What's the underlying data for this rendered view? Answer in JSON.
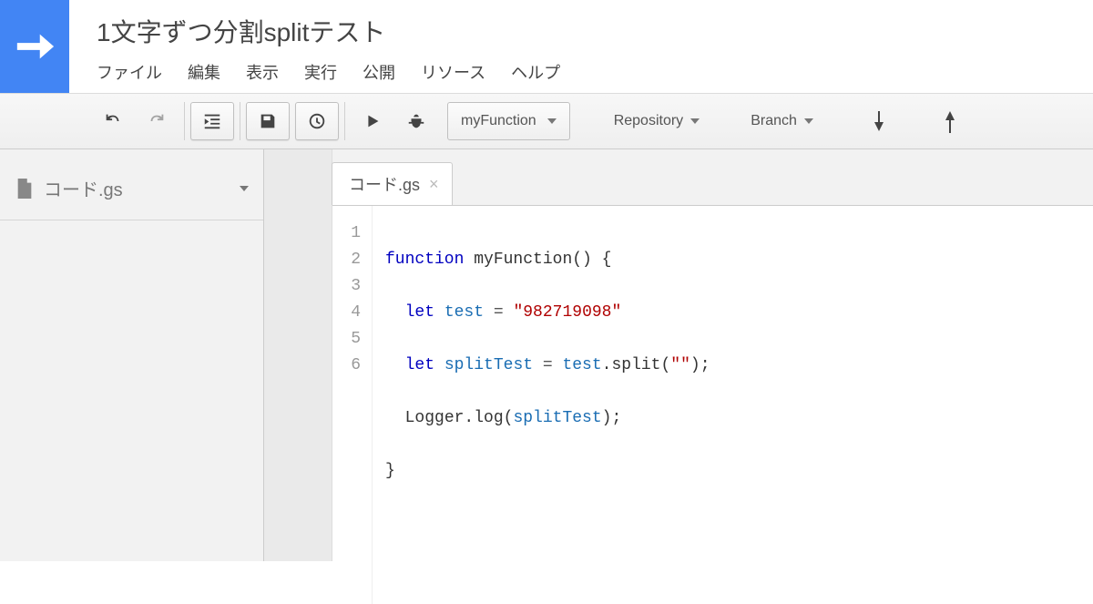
{
  "header": {
    "project_title": "1文字ずつ分割splitテスト",
    "menu": {
      "file": "ファイル",
      "edit": "編集",
      "view": "表示",
      "run": "実行",
      "publish": "公開",
      "resources": "リソース",
      "help": "ヘルプ"
    }
  },
  "toolbar": {
    "function_select": "myFunction",
    "repository": "Repository",
    "branch": "Branch"
  },
  "sidebar": {
    "files": [
      {
        "name": "コード.gs"
      }
    ]
  },
  "editor": {
    "tab_label": "コード.gs",
    "line_numbers": [
      "1",
      "2",
      "3",
      "4",
      "5",
      "6"
    ],
    "code": {
      "l1": {
        "kw": "function",
        "fn": " myFunction() {"
      },
      "l2": {
        "indent": "  ",
        "kw": "let",
        "sp": " ",
        "var": "test",
        "eq": " = ",
        "str": "\"982719098\""
      },
      "l3": {
        "indent": "  ",
        "kw": "let",
        "sp": " ",
        "var": "splitTest",
        "eq": " = ",
        "obj": "test",
        "call1": ".split(",
        "arg": "\"\"",
        "call2": ");"
      },
      "l4": {
        "indent": "  ",
        "obj": "Logger",
        "call1": ".log(",
        "var": "splitTest",
        "call2": ");"
      },
      "l5": {
        "brace": "}"
      }
    }
  }
}
